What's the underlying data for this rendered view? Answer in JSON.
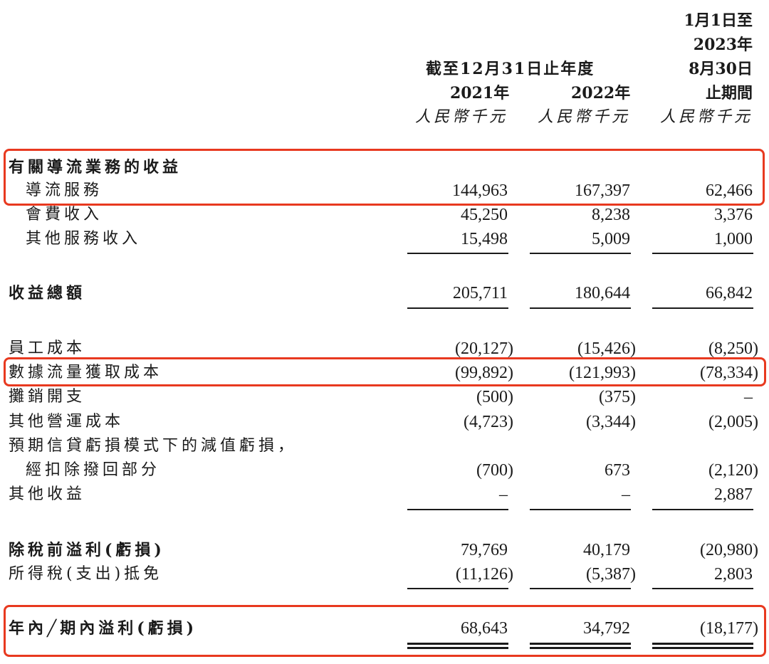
{
  "header": {
    "period3_line1": "1月1日至",
    "period3_line2": "2023年",
    "period3_line3": "8月30日",
    "period3_line4": "止期間",
    "group_label": "截至12月31日止年度",
    "year1": "2021年",
    "year2": "2022年",
    "currency": "人民幣千元"
  },
  "rows": [
    {
      "label": "有關導流業務的收益",
      "v1": "",
      "v2": "",
      "v3": ""
    },
    {
      "label": "導流服務",
      "v1": "144,963",
      "v2": "167,397",
      "v3": "62,466"
    },
    {
      "label": "會費收入",
      "v1": "45,250",
      "v2": "8,238",
      "v3": "3,376"
    },
    {
      "label": "其他服務收入",
      "v1": "15,498",
      "v2": "5,009",
      "v3": "1,000"
    },
    {
      "label": "收益總額",
      "v1": "205,711",
      "v2": "180,644",
      "v3": "66,842"
    },
    {
      "label": "員工成本",
      "v1": "(20,127)",
      "v2": "(15,426)",
      "v3": "(8,250)"
    },
    {
      "label": "數據流量獲取成本",
      "v1": "(99,892)",
      "v2": "(121,993)",
      "v3": "(78,334)"
    },
    {
      "label": "攤銷開支",
      "v1": "(500)",
      "v2": "(375)",
      "v3": "–"
    },
    {
      "label": "其他營運成本",
      "v1": "(4,723)",
      "v2": "(3,344)",
      "v3": "(2,005)"
    },
    {
      "label": "預期信貸虧損模式下的減值虧損，",
      "v1": "",
      "v2": "",
      "v3": ""
    },
    {
      "label": "經扣除撥回部分",
      "v1": "(700)",
      "v2": "673",
      "v3": "(2,120)"
    },
    {
      "label": "其他收益",
      "v1": "–",
      "v2": "–",
      "v3": "2,887"
    },
    {
      "label": "除稅前溢利(虧損)",
      "v1": "79,769",
      "v2": "40,179",
      "v3": "(20,980)"
    },
    {
      "label": "所得稅(支出)抵免",
      "v1": "(11,126)",
      "v2": "(5,387)",
      "v3": "2,803"
    },
    {
      "label": "年內╱期內溢利(虧損)",
      "v1": "68,643",
      "v2": "34,792",
      "v3": "(18,177)"
    }
  ],
  "colors": {
    "highlight": "#e8391f",
    "text": "#1a1a1a"
  }
}
